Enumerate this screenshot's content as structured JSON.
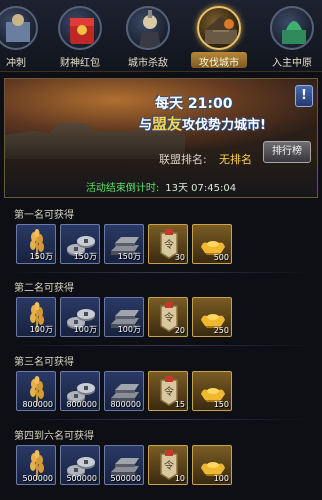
{
  "tabs": [
    {
      "label": "冲刺",
      "icon": "horse-rider-icon",
      "active": false
    },
    {
      "label": "财神红包",
      "icon": "red-envelope-icon",
      "active": false
    },
    {
      "label": "城市杀敌",
      "icon": "warrior-icon",
      "active": false
    },
    {
      "label": "攻伐城市",
      "icon": "burning-city-icon",
      "active": true
    },
    {
      "label": "入主中原",
      "icon": "jade-seal-icon",
      "active": false
    }
  ],
  "banner": {
    "line1": "每天 21:00",
    "line2_pre": "与",
    "line2_hl": "盟友",
    "line2_post": "攻伐势力城市!",
    "rank_label": "联盟排名:",
    "rank_value": "无排名",
    "rank_button": "排行榜",
    "info_button": "!",
    "countdown_label": "活动结束倒计时:",
    "countdown_value": "13天 07:45:04"
  },
  "sections": [
    {
      "title": "第一名可获得",
      "items": [
        {
          "icon": "wheat-icon",
          "qty": "150万"
        },
        {
          "icon": "coins-icon",
          "qty": "150万"
        },
        {
          "icon": "iron-ingot-icon",
          "qty": "150万"
        },
        {
          "icon": "token-icon",
          "qty": "30"
        },
        {
          "icon": "gold-ingot-icon",
          "qty": "500"
        }
      ]
    },
    {
      "title": "第二名可获得",
      "items": [
        {
          "icon": "wheat-icon",
          "qty": "100万"
        },
        {
          "icon": "coins-icon",
          "qty": "100万"
        },
        {
          "icon": "iron-ingot-icon",
          "qty": "100万"
        },
        {
          "icon": "token-icon",
          "qty": "20"
        },
        {
          "icon": "gold-ingot-icon",
          "qty": "250"
        }
      ]
    },
    {
      "title": "第三名可获得",
      "items": [
        {
          "icon": "wheat-icon",
          "qty": "800000"
        },
        {
          "icon": "coins-icon",
          "qty": "800000"
        },
        {
          "icon": "iron-ingot-icon",
          "qty": "800000"
        },
        {
          "icon": "token-icon",
          "qty": "15"
        },
        {
          "icon": "gold-ingot-icon",
          "qty": "150"
        }
      ]
    },
    {
      "title": "第四到六名可获得",
      "items": [
        {
          "icon": "wheat-icon",
          "qty": "500000"
        },
        {
          "icon": "coins-icon",
          "qty": "500000"
        },
        {
          "icon": "iron-ingot-icon",
          "qty": "500000"
        },
        {
          "icon": "token-icon",
          "qty": "10"
        },
        {
          "icon": "gold-ingot-icon",
          "qty": "100"
        }
      ]
    }
  ],
  "colors": {
    "accent_gold": "#ffd24a",
    "countdown_green": "#5de06a",
    "slot_blue": "#2a3a66",
    "slot_gold": "#7a5c24"
  }
}
